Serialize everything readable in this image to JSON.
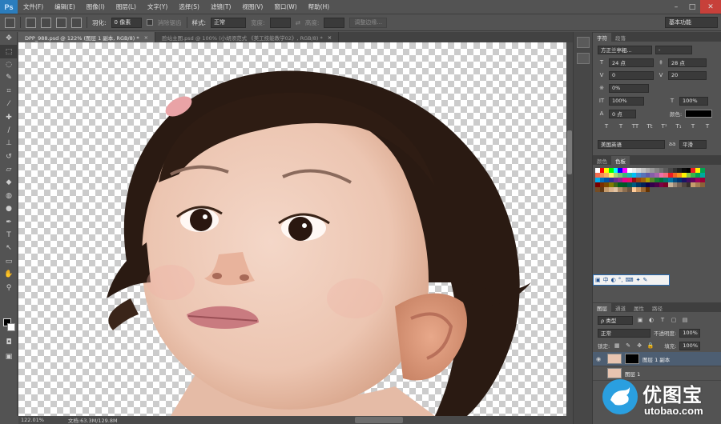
{
  "app": {
    "logo": "Ps",
    "menu": [
      "文件(F)",
      "编辑(E)",
      "图像(I)",
      "图层(L)",
      "文字(Y)",
      "选择(S)",
      "滤镜(T)",
      "视图(V)",
      "窗口(W)",
      "帮助(H)"
    ],
    "window_controls": [
      "–",
      "□",
      "✕"
    ]
  },
  "options": {
    "feather_label": "羽化:",
    "feather_value": "0 像素",
    "antialias_label": "消除锯齿",
    "style_label": "样式:",
    "style_value": "正常",
    "width_label": "宽度:",
    "height_label": "高度:",
    "refine_edge_button": "调整边缘...",
    "workspace": "基本功能"
  },
  "tabs": [
    {
      "label": "DPP_988.psd @ 122% (图层 1 副本, RGB/8) *",
      "active": true
    },
    {
      "label": "脸站主图.psd @ 100% (小胡须范式 《美工技能教学02》, RGB/8) *",
      "active": false
    }
  ],
  "status": {
    "zoom": "122.01%",
    "doc": "文档:63.3M/129.8M"
  },
  "character_panel": {
    "tabs": [
      "字符",
      "段落"
    ],
    "font_family": "方正兰亭粗...",
    "font_style": "-",
    "font_size": "24 点",
    "leading": "28 点",
    "kerning": "0",
    "tracking": "20",
    "scale_pct": "0%",
    "vertical_scale": "100%",
    "horizontal_scale": "100%",
    "baseline": "0 点",
    "color_label": "颜色:",
    "style_buttons": [
      "T",
      "T",
      "TT",
      "Tt",
      "T¹",
      "T₁",
      "T",
      "T"
    ],
    "language": "美国英语",
    "aa_icon": "aa",
    "antialias": "平滑"
  },
  "swatches_panel": {
    "tabs": [
      "颜色",
      "色板"
    ]
  },
  "layers_panel": {
    "tabs": [
      "图层",
      "通道",
      "属性",
      "路径"
    ],
    "filter_type": "ρ 类型",
    "blend_mode": "正常",
    "opacity_label": "不透明度:",
    "opacity_value": "100%",
    "lock_label": "锁定:",
    "fill_label": "填充:",
    "fill_value": "100%",
    "layers": [
      {
        "name": "图层 1 副本",
        "selected": true
      },
      {
        "name": "图层 1",
        "selected": false
      }
    ]
  },
  "ime_bar": [
    "中",
    "◐",
    "°,",
    "⌨",
    "✦",
    "✎"
  ],
  "watermark": {
    "title": "优图宝",
    "url": "utobao.com"
  },
  "colors": {
    "swatches": [
      "#ffffff",
      "#ff0000",
      "#ffff00",
      "#00ff00",
      "#00ffff",
      "#0000ff",
      "#ff00ff",
      "#ffffff",
      "#ebebeb",
      "#d6d6d6",
      "#c2c2c2",
      "#adadad",
      "#999999",
      "#858585",
      "#707070",
      "#5c5c5c",
      "#474747",
      "#333333",
      "#1f1f1f",
      "#0a0a0a",
      "#000000",
      "#ed1c24",
      "#fff200",
      "#00a651",
      "#f26c4f",
      "#f68e55",
      "#fbaf5c",
      "#fff467",
      "#acd372",
      "#7cc576",
      "#3bb878",
      "#1abbb4",
      "#00bff3",
      "#438ccb",
      "#5574b9",
      "#605ca8",
      "#855fa8",
      "#a763a9",
      "#f06ea9",
      "#f26d7d",
      "#ed1c24",
      "#f26522",
      "#f7941d",
      "#fff200",
      "#8dc63f",
      "#39b54a",
      "#00a651",
      "#00a99d",
      "#00aeef",
      "#0072bc",
      "#0054a6",
      "#2e3192",
      "#662d91",
      "#92278f",
      "#ec008c",
      "#ed145b",
      "#9e0b0f",
      "#a0410d",
      "#a3620a",
      "#aba000",
      "#598527",
      "#197b30",
      "#007236",
      "#00746b",
      "#0076a3",
      "#004a80",
      "#003471",
      "#1b1464",
      "#440e62",
      "#630460",
      "#9e005d",
      "#9e0039",
      "#790000",
      "#7b2e00",
      "#7d4900",
      "#827b00",
      "#406618",
      "#005e20",
      "#005826",
      "#005952",
      "#005b7f",
      "#003663",
      "#002157",
      "#0d004c",
      "#32004b",
      "#4b0049",
      "#7b0046",
      "#7a0026",
      "#c7b299",
      "#998675",
      "#736357",
      "#534741",
      "#37302d",
      "#c69c6d",
      "#a67c52",
      "#8c6239",
      "#754c24",
      "#603913",
      "#c69c6d",
      "#d9b38c",
      "#e2c4a3",
      "#b38f6b",
      "#8c6e4f",
      "#6e5540",
      "#ffcc99",
      "#cc9966",
      "#996633",
      "#663300"
    ]
  }
}
